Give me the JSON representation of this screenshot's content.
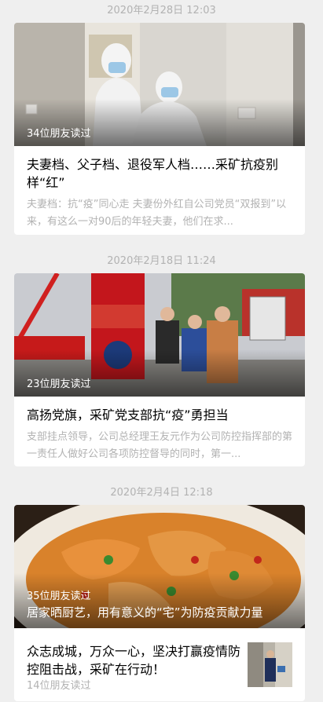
{
  "articles": [
    {
      "date": "2020年2月28日 12:03",
      "readers": "34位朋友读过",
      "title": "夫妻档、父子档、退役军人档……采矿抗疫别样“红”",
      "digest": "夫妻档：抗“疫”同心走 夫妻份外红自公司党员“双报到”以来，有这么一对90后的年轻夫妻，他们在求..."
    },
    {
      "date": "2020年2月18日 11:24",
      "readers": "23位朋友读过",
      "title": "高扬党旗，采矿党支部抗“疫”勇担当",
      "digest": "支部挂点领导，公司总经理王友元作为公司防控指挥部的第一责任人做好公司各项防控督导的同时，第一..."
    },
    {
      "date": "2020年2月4日 12:18",
      "readers": "35位朋友读过",
      "title": "居家晒厨艺，用有意义的“宅”为防疫贡献力量",
      "sub": {
        "title": "众志成城，万众一心，坚决打赢疫情防控阻击战，采矿在行动！",
        "readers": "14位朋友读过"
      }
    }
  ]
}
